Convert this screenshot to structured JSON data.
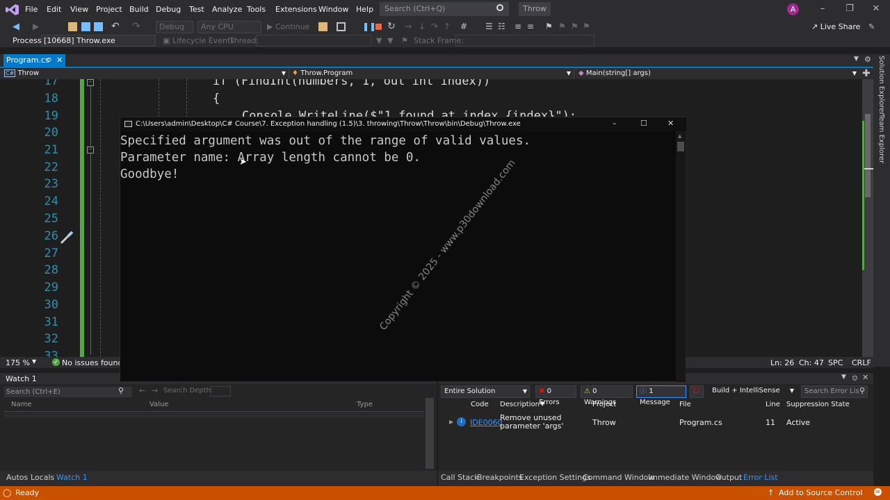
{
  "menu": [
    "File",
    "Edit",
    "View",
    "Project",
    "Build",
    "Debug",
    "Test",
    "Analyze",
    "Tools",
    "Extensions",
    "Window",
    "Help"
  ],
  "search": {
    "placeholder": "Search (Ctrl+Q)"
  },
  "solution_title": "Throw",
  "avatar_initial": "A",
  "toolbar": {
    "config": "Debug",
    "platform": "Any CPU",
    "continue_label": "Continue",
    "live_share": "Live Share"
  },
  "debugbar": {
    "process_label": "Process:",
    "process_value": "[10668] Throw.exe",
    "lifecycle": "Lifecycle Events",
    "thread_label": "Thread:",
    "stack_label": "Stack Frame:"
  },
  "doc_tab": "Program.cs",
  "nav": {
    "project": "Throw",
    "type": "Throw.Program",
    "member": "Main(string[] args)"
  },
  "editor": {
    "line_numbers": [
      "17",
      "18",
      "19",
      "20",
      "21",
      "22",
      "23",
      "24",
      "25",
      "26",
      "27",
      "28",
      "29",
      "30",
      "31",
      "32",
      "33"
    ],
    "code_line_17": "if (FindInt(numbers, 1, out int index))",
    "code_line_18": "{",
    "code_line_19": "Console.WriteLine($\"1 found at index {index}\");"
  },
  "side_tabs": [
    "Solution Explorer",
    "Team Explorer"
  ],
  "editor_status": {
    "zoom": "175 %",
    "issues": "No issues found",
    "line": "Ln: 26",
    "col": "Ch: 47",
    "spc": "SPC",
    "eol": "CRLF"
  },
  "console": {
    "title": "C:\\Users\\admin\\Desktop\\C# Course\\7. Exception handling (1.5)\\3. throwing\\Throw\\Throw\\bin\\Debug\\Throw.exe",
    "lines": [
      "Specified argument was out of the range of valid values.",
      "Parameter name: Array length cannot be 0.",
      "Goodbye!"
    ],
    "watermark": "Copyright © 2025 - www.p30download.com"
  },
  "watch": {
    "title": "Watch 1",
    "search_placeholder": "Search (Ctrl+E)",
    "search_depth": "Search Depth:",
    "columns": [
      "Name",
      "Value",
      "Type"
    ],
    "tabs": [
      "Autos",
      "Locals",
      "Watch 1"
    ]
  },
  "error_list": {
    "scope": "Entire Solution",
    "errors": "0 Errors",
    "warnings": "0 Warnings",
    "messages": "1 Message",
    "build_filter": "Build + IntelliSense",
    "search_placeholder": "Search Error Lis",
    "columns": [
      "Code",
      "Description",
      "Project",
      "File",
      "Line",
      "Suppression State"
    ],
    "rows": [
      {
        "code": "IDE0060",
        "description": "Remove unused parameter 'args'",
        "project": "Throw",
        "file": "Program.cs",
        "line": "11",
        "state": "Active"
      }
    ],
    "tabs": [
      "Call Stack",
      "Breakpoints",
      "Exception Settings",
      "Command Window",
      "Immediate Window",
      "Output",
      "Error List"
    ]
  },
  "status": {
    "ready": "Ready",
    "source_control": "Add to Source Control"
  },
  "colors": {
    "accent": "#007acc",
    "status_bar": "#ca5100",
    "line_numbers": "#2b91af"
  }
}
